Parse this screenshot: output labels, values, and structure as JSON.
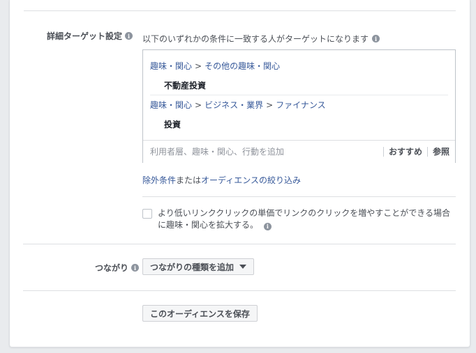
{
  "detailed_targeting": {
    "label": "詳細ターゲット設定",
    "description": "以下のいずれかの条件に一致する人がターゲットになります",
    "groups": [
      {
        "breadcrumb": [
          "趣味・関心",
          "その他の趣味・関心"
        ],
        "item": "不動産投資"
      },
      {
        "breadcrumb": [
          "趣味・関心",
          "ビジネス・業界",
          "ファイナンス"
        ],
        "item": "投資"
      }
    ],
    "input_placeholder": "利用者層、趣味・関心、行動を追加",
    "suggestions_label": "おすすめ",
    "browse_label": "参照",
    "exclude_link": "除外条件",
    "or_text": "または",
    "narrow_link": "オーディエンスの絞り込み",
    "expand_checkbox_label": "より低いリンククリックの単価でリンクのクリックを増やすことができる場合に趣味・関心を拡大する。",
    "info_glyph": "i"
  },
  "connections": {
    "label": "つながり",
    "add_button": "つながりの種類を追加"
  },
  "save_button": "このオーディエンスを保存"
}
